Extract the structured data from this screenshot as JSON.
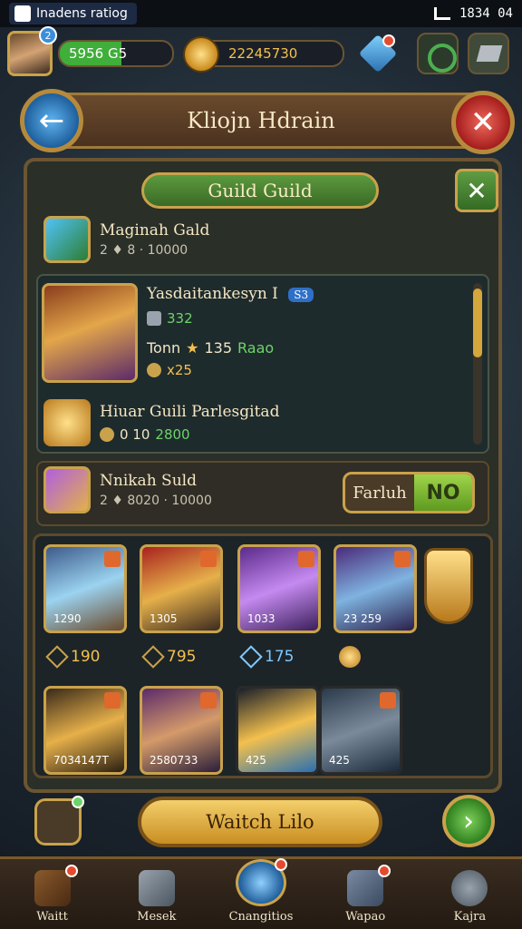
{
  "statusbar": {
    "app_label": "Inadens ratiog",
    "time": "1834 04"
  },
  "player": {
    "level": "2",
    "exp_value": "5956 G5",
    "gold_value": "22245730"
  },
  "header": {
    "title": "Kliojn Hdrain"
  },
  "guild_tab": {
    "label": "Guild Guild"
  },
  "guild_row": {
    "title": "Maginah Gald",
    "sub": "2 ♦ 8 · 10000"
  },
  "featured_hero": {
    "name": "Yasdaitankesyn I",
    "badge": "S3",
    "stat1": "332",
    "tonn_label": "Tonn",
    "tonn_value": "135",
    "tonn_extra": "Raao",
    "reward": "x25"
  },
  "guild_reward": {
    "title": "Hiuar Guili Parlesgitad",
    "value": "0 10",
    "extra": "2800"
  },
  "nukah_row": {
    "title": "Nnikah Suld",
    "sub": "2 ♦ 8020 · 10000",
    "btn_left": "Farluh",
    "btn_right": "NO"
  },
  "cards_row1": [
    {
      "val": "1290",
      "footer": "190"
    },
    {
      "val": "1305",
      "footer": "795"
    },
    {
      "val": "1033",
      "footer": "175"
    },
    {
      "val": "23 259",
      "footer": ""
    }
  ],
  "cards_row2": [
    {
      "val": "7034147T"
    },
    {
      "val": "2580733"
    },
    {
      "val": "425"
    },
    {
      "val": "425"
    }
  ],
  "actions": {
    "watch_label": "Waitch Lilo"
  },
  "nav": [
    {
      "label": "Waitt"
    },
    {
      "label": "Mesek"
    },
    {
      "label": "Cnangitios"
    },
    {
      "label": "Wapao"
    },
    {
      "label": "Kajra"
    }
  ],
  "colors": {
    "accent_gold": "#c9a24b",
    "green": "#5c9a3e",
    "red": "#a41d1d",
    "blue": "#1e5f9c"
  }
}
